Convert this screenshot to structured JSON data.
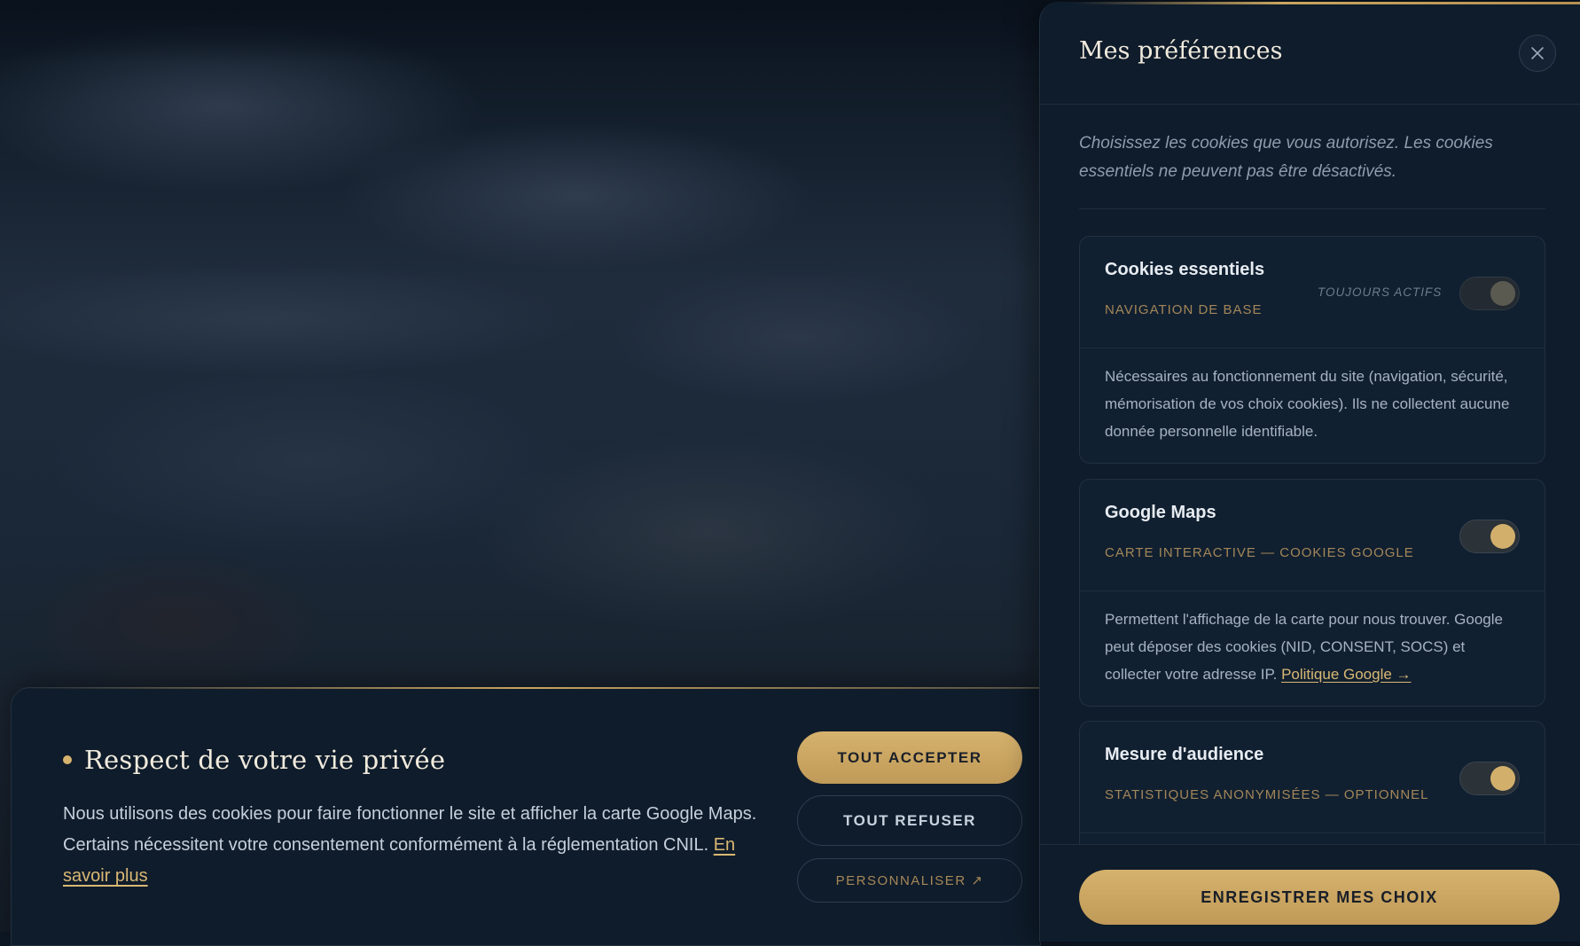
{
  "banner": {
    "title": "Respect de votre vie privée",
    "text": "Nous utilisons des cookies pour faire fonctionner le site et afficher la carte Google Maps. Certains nécessitent votre consentement conformément à la réglementation CNIL. ",
    "link_label": "En savoir plus",
    "accept_label": "TOUT ACCEPTER",
    "refuse_label": "TOUT REFUSER",
    "customize_label": "PERSONNALISER ↗"
  },
  "panel": {
    "title": "Mes préférences",
    "close_icon": "close-icon",
    "intro": "Choisissez les cookies que vous autorisez. Les cookies essentiels ne peuvent pas être désactivés.",
    "categories": [
      {
        "name": "Cookies essentiels",
        "subtitle": "NAVIGATION DE BASE",
        "status": "TOUJOURS ACTIFS",
        "enabled": true,
        "locked": true,
        "description": "Nécessaires au fonctionnement du site (navigation, sécurité, mémorisation de vos choix cookies). Ils ne collectent aucune donnée personnelle identifiable."
      },
      {
        "name": "Google Maps",
        "subtitle": "CARTE INTERACTIVE — COOKIES GOOGLE",
        "enabled": true,
        "locked": false,
        "description": "Permettent l'affichage de la carte pour nous trouver. Google peut déposer des cookies (NID, CONSENT, SOCS) et collecter votre adresse IP. ",
        "link_label": "Politique Google →"
      },
      {
        "name": "Mesure d'audience",
        "subtitle": "STATISTIQUES ANONYMISÉES — OPTIONNEL",
        "enabled": true,
        "locked": false
      }
    ],
    "save_label": "ENREGISTRER MES CHOIX"
  },
  "colors": {
    "accent_gold": "#d6b36f",
    "panel_bg": "#0f1c2b",
    "text_light": "#f1ebdd"
  }
}
